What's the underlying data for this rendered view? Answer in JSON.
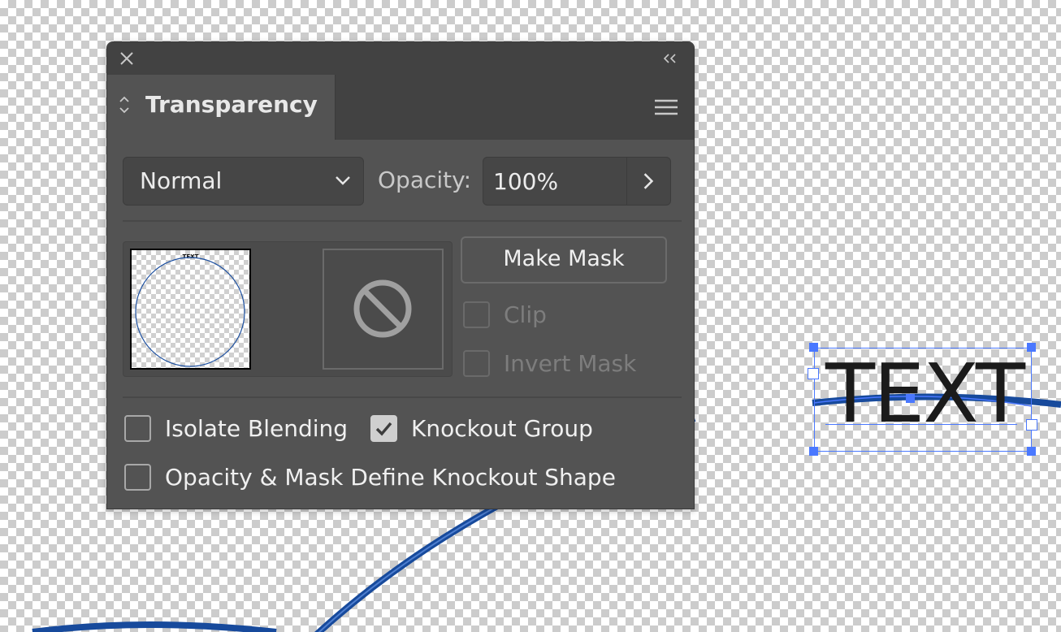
{
  "canvas": {
    "text_object": "TEXT",
    "stroke_color": "#1a4ea0",
    "selection_color": "#4a78ff"
  },
  "panel": {
    "title": "Transparency",
    "icons": {
      "close": "close-icon",
      "collapse": "double-chevron-left-icon",
      "menu": "hamburger-menu-icon",
      "tab_toggle": "up-down-chevron-icon"
    },
    "blend_mode": {
      "selected": "Normal"
    },
    "opacity": {
      "label": "Opacity:",
      "value": "100%"
    },
    "thumbnail": {
      "label": "TEXT"
    },
    "mask_slot_icon": "no-mask-icon",
    "make_mask_label": "Make Mask",
    "clip": {
      "label": "Clip",
      "checked": false,
      "enabled": false
    },
    "invert_mask": {
      "label": "Invert Mask",
      "checked": false,
      "enabled": false
    },
    "isolate_blending": {
      "label": "Isolate Blending",
      "checked": false
    },
    "knockout_group": {
      "label": "Knockout Group",
      "checked": true
    },
    "opacity_mask_knockout": {
      "label": "Opacity & Mask Define Knockout Shape",
      "checked": false
    },
    "colors": {
      "panel_bg": "#535353",
      "header_bg": "#424242",
      "text": "#e6e6e6",
      "disabled_text": "#7d7d7d"
    }
  }
}
